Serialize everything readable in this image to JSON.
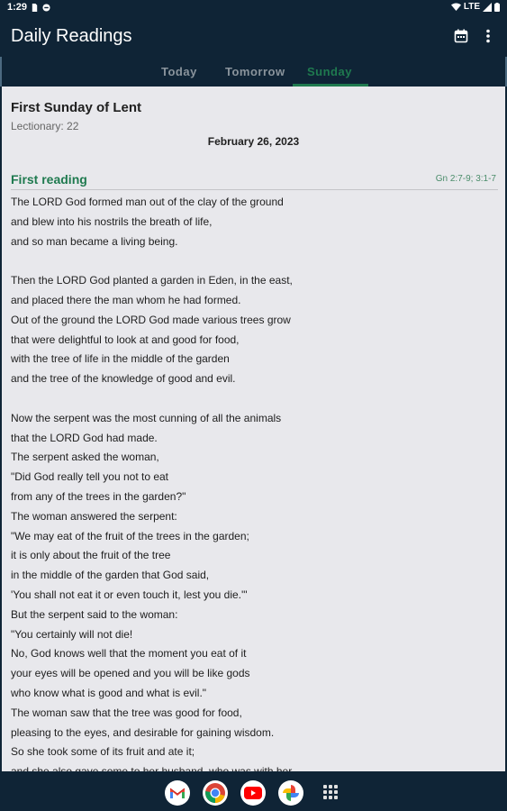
{
  "status_bar": {
    "time": "1:29",
    "network": "LTE"
  },
  "app_bar": {
    "title": "Daily Readings",
    "actions": [
      {
        "icon": "calendar-icon"
      },
      {
        "icon": "more-vert-icon"
      }
    ]
  },
  "tabs": [
    {
      "label": "Today",
      "active": false
    },
    {
      "label": "Tomorrow",
      "active": false
    },
    {
      "label": "Sunday",
      "active": true
    }
  ],
  "colors": {
    "app_bar": "#0f2436",
    "accent": "#1f7a4f",
    "content_bg": "#e8e8ec"
  },
  "day": {
    "title": "First Sunday of Lent",
    "lectionary": "Lectionary: 22",
    "date": "February 26, 2023"
  },
  "reading": {
    "heading": "First reading",
    "citation": "Gn 2:7-9; 3:1-7",
    "lines": [
      "The LORD God formed man out of the clay of the ground",
      "and blew into his nostrils the breath of life,",
      "and so man became a living being.",
      "",
      "Then the LORD God planted a garden in Eden, in the east,",
      "and placed there the man whom he had formed.",
      "Out of the ground the LORD God made various trees grow",
      "that were delightful to look at and good for food,",
      "with the tree of life in the middle of the garden",
      "and the tree of the knowledge of good and evil.",
      "",
      "Now the serpent was the most cunning of all the animals",
      "that the LORD God had made.",
      "The serpent asked the woman,",
      "\"Did God really tell you not to eat",
      "from any of the trees in the garden?\"",
      "The woman answered the serpent:",
      "\"We may eat of the fruit of the trees in the garden;",
      "it is only about the fruit of the tree",
      "in the middle of the garden that God said,",
      "'You shall not eat it or even touch it, lest you die.'\"",
      "But the serpent said to the woman:",
      "\"You certainly will not die!",
      "No, God knows well that the moment you eat of it",
      "your eyes will be opened and you will be like gods",
      "who know what is good and what is evil.\"",
      "The woman saw that the tree was good for food,",
      "pleasing to the eyes, and desirable for gaining wisdom.",
      "So she took some of its fruit and ate it;",
      "and she also gave some to her husband, who was with her,"
    ]
  },
  "nav_bar": {
    "apps": [
      {
        "icon": "gmail-icon"
      },
      {
        "icon": "chrome-icon"
      },
      {
        "icon": "youtube-icon"
      },
      {
        "icon": "photos-icon"
      },
      {
        "icon": "app-drawer-icon"
      }
    ]
  }
}
